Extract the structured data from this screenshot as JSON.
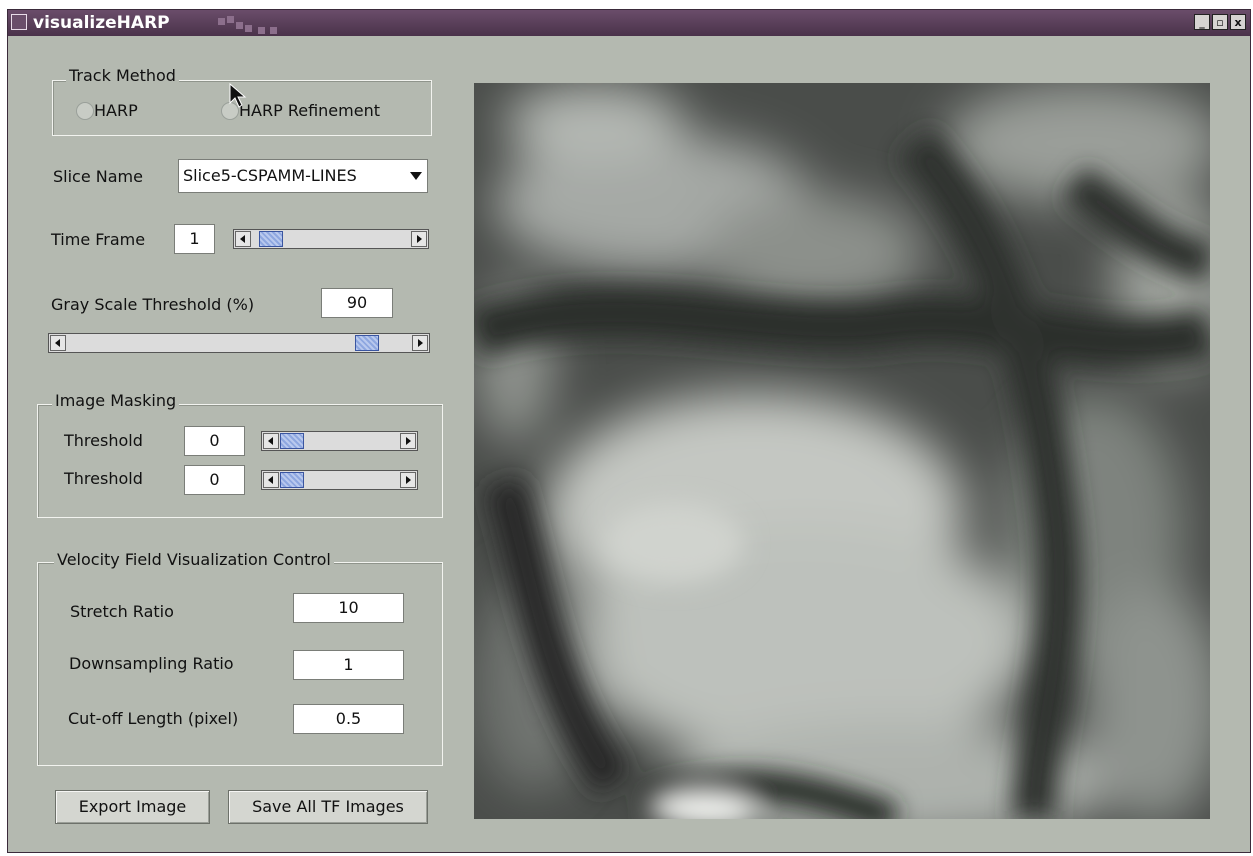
{
  "window": {
    "title": "visualizeHARP",
    "controls": {
      "minimize": "_",
      "maximize": "▫",
      "close": "x"
    }
  },
  "track_method": {
    "legend": "Track Method",
    "options": [
      {
        "label": "HARP",
        "selected": false
      },
      {
        "label": "HARP Refinement",
        "selected": false
      }
    ]
  },
  "slice": {
    "label": "Slice Name",
    "value": "Slice5-CSPAMM-LINES"
  },
  "time_frame": {
    "label": "Time Frame",
    "value": "1",
    "slider_fraction": 0.05
  },
  "gray_threshold": {
    "label": "Gray Scale Threshold (%)",
    "value": "90",
    "slider_fraction": 0.9
  },
  "image_masking": {
    "legend": "Image Masking",
    "rows": [
      {
        "label": "Threshold",
        "value": "0",
        "slider_fraction": 0.0
      },
      {
        "label": "Threshold",
        "value": "0",
        "slider_fraction": 0.0
      }
    ]
  },
  "velocity": {
    "legend": "Velocity Field Visualization Control",
    "stretch_ratio": {
      "label": "Stretch Ratio",
      "value": "10"
    },
    "downsampling_ratio": {
      "label": "Downsampling Ratio",
      "value": "1"
    },
    "cutoff_length": {
      "label": "Cut-off Length (pixel)",
      "value": "0.5"
    }
  },
  "buttons": {
    "export": "Export Image",
    "save_all": "Save All TF Images"
  },
  "colors": {
    "titlebar": "#4f374f",
    "panel": "#b4b9b0",
    "slider_thumb": "#9fb4e6"
  }
}
